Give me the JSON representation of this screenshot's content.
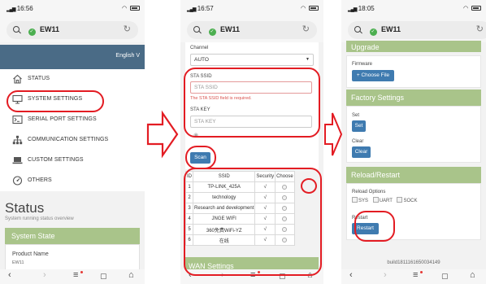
{
  "panels": [
    {
      "time": "16:56",
      "host": "EW11",
      "language": "English",
      "menu": [
        "STATUS",
        "SYSTEM SETTINGS",
        "SERIAL PORT SETTINGS",
        "COMMUNICATION SETTINGS",
        "CUSTOM SETTINGS",
        "OTHERS"
      ],
      "status_title": "Status",
      "status_subtitle": "System running status overview",
      "system_state": "System State",
      "product_name_label": "Product Name",
      "product_name_value": "EW11"
    },
    {
      "time": "16:57",
      "host": "EW11",
      "channel_label": "Channel",
      "channel_value": "AUTO",
      "sta_ssid_label": "STA SSID",
      "sta_ssid_placeholder": "STA SSID",
      "sta_ssid_error": "The STA SSID field is required.",
      "sta_key_label": "STA KEY",
      "sta_key_placeholder": "STA KEY",
      "scan_label": "Scan",
      "table_headers": [
        "ID",
        "SSID",
        "Security",
        "Choose"
      ],
      "table_rows": [
        {
          "id": "1",
          "ssid": "TP-LINK_425A",
          "security": "√"
        },
        {
          "id": "2",
          "ssid": "technology",
          "security": "√"
        },
        {
          "id": "3",
          "ssid": "Research and development",
          "security": "√"
        },
        {
          "id": "4",
          "ssid": "JNGE WIFI",
          "security": "√"
        },
        {
          "id": "5",
          "ssid": "360免费WiFi-YZ",
          "security": "√"
        },
        {
          "id": "6",
          "ssid": "在线",
          "security": "√"
        }
      ],
      "wan_settings": "WAN Settings"
    },
    {
      "time": "18:05",
      "host": "EW11",
      "upgrade": "Upgrade",
      "firmware_label": "Firmware",
      "choose_file": "+ Choose File",
      "factory_settings": "Factory Settings",
      "set_label": "Set",
      "set_button": "Set",
      "clear_label": "Clear",
      "clear_button": "Clear",
      "reload_restart": "Reload/Restart",
      "reload_options": "Reload Options",
      "options": [
        "SYS",
        "UART",
        "SOCK"
      ],
      "restart_label": "Restart",
      "restart_button": "Restart",
      "build": "build1811161650034149"
    }
  ],
  "colors": {
    "highlight": "#e31c23",
    "section_header": "#a9c48a",
    "brand_band": "#4a6b86",
    "button": "#3f7bb0"
  }
}
